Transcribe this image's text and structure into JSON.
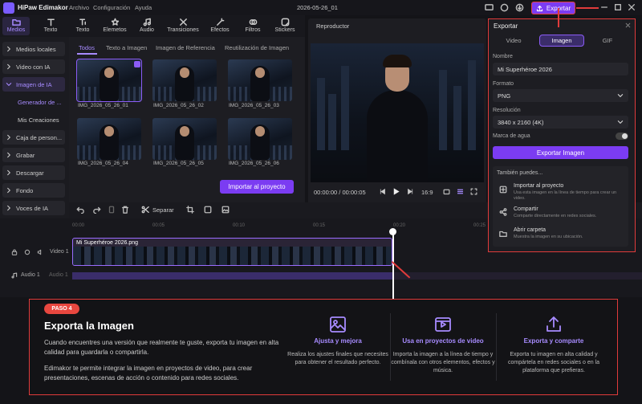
{
  "app": {
    "name": "HiPaw Edimakor",
    "menus": [
      "Archivo",
      "Configuración",
      "Ayuda"
    ],
    "project_title": "2026-05-26_01",
    "export_label": "Exportar"
  },
  "toolbar": [
    {
      "label": "Medios",
      "icon": "folder-icon"
    },
    {
      "label": "Texto",
      "icon": "text-icon"
    },
    {
      "label": "Texto",
      "icon": "text-to-speech-icon"
    },
    {
      "label": "Elemetos",
      "icon": "elements-icon"
    },
    {
      "label": "Audio",
      "icon": "audio-icon"
    },
    {
      "label": "Transiciones",
      "icon": "transitions-icon"
    },
    {
      "label": "Efectos",
      "icon": "effects-icon"
    },
    {
      "label": "Filtros",
      "icon": "filters-icon"
    },
    {
      "label": "Stickers",
      "icon": "stickers-icon"
    }
  ],
  "sidebar": [
    {
      "label": "Medios locales"
    },
    {
      "label": "Video con IA"
    },
    {
      "label": "Imagen de IA"
    },
    {
      "label": "Generador de ..."
    },
    {
      "label": "Mis Creaciones"
    },
    {
      "label": "Caja de person..."
    },
    {
      "label": "Grabar"
    },
    {
      "label": "Descargar"
    },
    {
      "label": "Fondo"
    },
    {
      "label": "Voces de IA"
    }
  ],
  "media": {
    "tabs": [
      "Todos",
      "Texto a Imagen",
      "Imagen de Referencia",
      "Reutilización de Imagen"
    ],
    "items": [
      "IMG_2026_05_26_01",
      "IMG_2026_05_26_02",
      "IMG_2026_05_26_03",
      "IMG_2026_05_26_04",
      "IMG_2026_05_26_05",
      "IMG_2026_05_26_06"
    ],
    "import_label": "Importar al proyecto"
  },
  "player": {
    "title": "Reproductor",
    "time": "00:00:00 / 00:00:05",
    "ratio": "16:9"
  },
  "timeline": {
    "split_label": "Separar",
    "ruler": [
      "00:00",
      "00:05",
      "00:10",
      "00:15",
      "00:20",
      "00:25"
    ],
    "clip_name": "Mi Superhéroe 2026.png",
    "video_track": "Video 1",
    "audio_track": "Audio 1",
    "audio_track2": "Audio 1"
  },
  "export_panel": {
    "title": "Exportar",
    "tabs": [
      "Video",
      "Imagen",
      "GIF"
    ],
    "name_label": "Nombre",
    "name_value": "Mi Superhéroe 2026",
    "format_label": "Formato",
    "format_value": "PNG",
    "resolution_label": "Resolución",
    "resolution_value": "3840 x 2160 (4K)",
    "watermark_label": "Marca de agua",
    "export_image_label": "Exportar Imagen",
    "also_label": "También puedes...",
    "options": [
      {
        "title": "Importar al proyecto",
        "desc": "Usa esta imagen en la línea de tiempo para crear un video."
      },
      {
        "title": "Compartir",
        "desc": "Comparte directamente en redes sociales."
      },
      {
        "title": "Abrir carpeta",
        "desc": "Muestra la imagen en su ubicación."
      }
    ]
  },
  "step": {
    "badge": "PASO 4",
    "title": "Exporta la Imagen",
    "p1": "Cuando encuentres una versión que realmente te guste, exporta tu imagen en alta calidad para guardarla o compartirla.",
    "p2": "Edimakor te permite integrar la imagen en proyectos de video, para crear presentaciones, escenas de acción o contenido para redes sociales.",
    "features": [
      {
        "title": "Ajusta y mejora",
        "desc": "Realiza los ajustes finales que necesites para obtener el resultado perfecto.",
        "icon": "image-edit-icon"
      },
      {
        "title": "Usa en proyectos de video",
        "desc": "Importa la imagen a la línea de tiempo y combínala con otros elementos, efectos y música.",
        "icon": "video-play-icon"
      },
      {
        "title": "Exporta y comparte",
        "desc": "Exporta tu imagen en alta calidad y compártela en redes sociales o en la plataforma que prefieras.",
        "icon": "share-upload-icon"
      }
    ]
  },
  "colors": {
    "accent": "#7b3cf2",
    "highlight": "#e03b3b",
    "badge": "#e8473f"
  }
}
